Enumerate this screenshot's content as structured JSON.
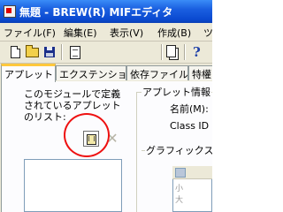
{
  "window": {
    "title": "無題 - BREW(R) MIFエディタ"
  },
  "menu": {
    "items": [
      "ファイル(F)",
      "編集(E)",
      "表示(V)",
      "作成(B)",
      "ツ"
    ]
  },
  "toolbar": {
    "icons": [
      "new-file-icon",
      "open-folder-icon",
      "save-disk-icon",
      "document-icon",
      "copy-document-icon",
      "help-icon"
    ],
    "help_glyph": "?"
  },
  "tabs": [
    "アプレット",
    "エクステンション",
    "依存ファイル",
    "特權"
  ],
  "applet_panel": {
    "description": "このモジュールで定義されているアプレットのリスト:",
    "add_glyph": "",
    "delete_glyph": "✕"
  },
  "applet_info": {
    "group_label": "アプレット情報",
    "name_label": "名前(M):",
    "classid_label": "Class ID",
    "graphics_label": "グラフィックス",
    "graphics_items": [
      "小",
      "大"
    ]
  },
  "colors": {
    "title_blue": "#0a49d0",
    "tab_accent": "#ffc83c",
    "highlight_red": "#ee1111"
  }
}
